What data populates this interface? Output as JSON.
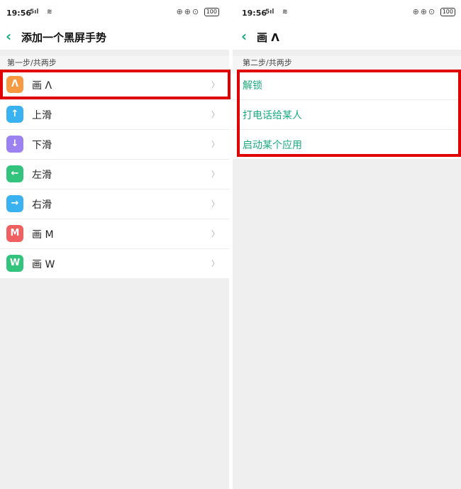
{
  "left": {
    "status": {
      "time": "19:56",
      "signal": "5ıl",
      "net": "4.0\nKB/s",
      "icons": "⊕⊕⊙",
      "battery": "100"
    },
    "title": "添加一个黑屏手势",
    "section": "第一步/共两步",
    "items": [
      {
        "label": "画 Λ",
        "glyph": "Λ",
        "icon_color": "#f59a42",
        "icon": "caret-icon"
      },
      {
        "label": "上滑",
        "glyph": "↑",
        "icon_color": "#3bb2f0",
        "icon": "arrow-up-icon"
      },
      {
        "label": "下滑",
        "glyph": "↓",
        "icon_color": "#9b82f0",
        "icon": "arrow-down-icon"
      },
      {
        "label": "左滑",
        "glyph": "←",
        "icon_color": "#32c47c",
        "icon": "arrow-left-icon"
      },
      {
        "label": "右滑",
        "glyph": "→",
        "icon_color": "#3bb2f0",
        "icon": "arrow-right-icon"
      },
      {
        "label": "画 M",
        "glyph": "M",
        "icon_color": "#f06060",
        "icon": "letter-m-icon"
      },
      {
        "label": "画 W",
        "glyph": "W",
        "icon_color": "#32c47c",
        "icon": "letter-w-icon"
      }
    ]
  },
  "right": {
    "status": {
      "time": "19:56",
      "signal": "5ıl",
      "net": "4.0\nKB/s",
      "icons": "⊕⊕⊙",
      "battery": "100"
    },
    "title": "画 Λ",
    "section": "第二步/共两步",
    "options": [
      {
        "label": "解锁"
      },
      {
        "label": "打电话给某人"
      },
      {
        "label": "启动某个应用"
      }
    ]
  },
  "chevron": "〉",
  "back_glyph": "‹",
  "highlight_color": "#e00000",
  "accent_color": "#1aaa7e"
}
